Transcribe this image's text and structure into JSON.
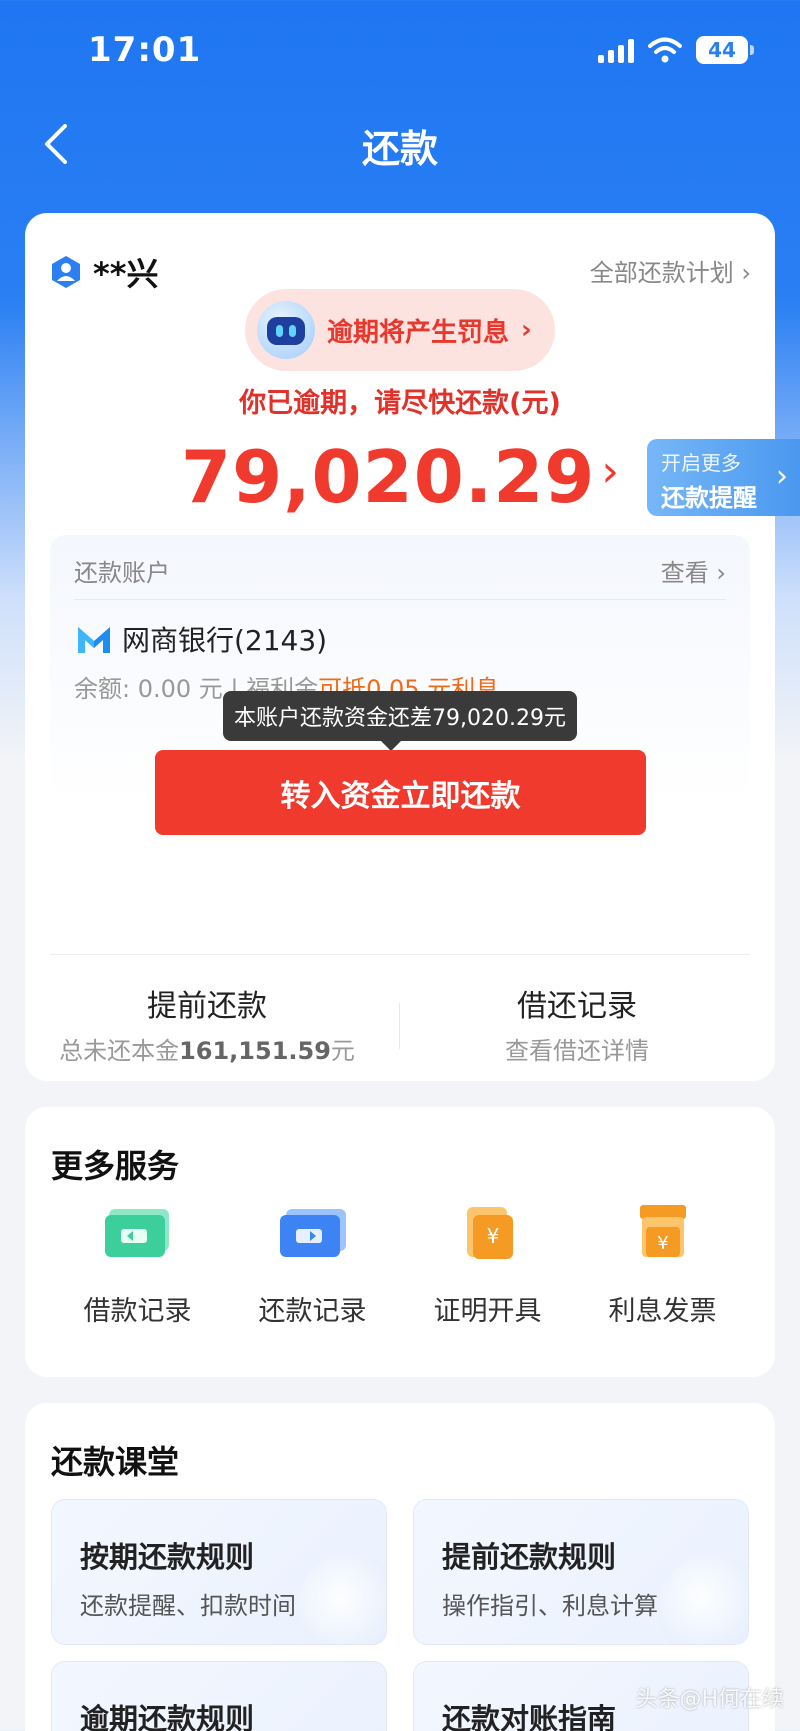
{
  "status_bar": {
    "time": "17:01",
    "battery": "44"
  },
  "nav": {
    "title": "还款"
  },
  "account_summary": {
    "user_name": "**兴",
    "all_plans_link": "全部还款计划",
    "overdue_pill": "逾期将产生罚息",
    "overdue_message": "你已逾期，请尽快还款(元)",
    "amount_due": "79,020.29",
    "reminder_tab": {
      "line1": "开启更多",
      "line2": "还款提醒"
    }
  },
  "repay_account": {
    "label": "还款账户",
    "view_link": "查看",
    "bank_name": "网商银行(2143)",
    "balance_prefix": "余额: 0.00 元 | 福利金",
    "balance_highlight": "可抵0.05 元利息",
    "tooltip": "本账户还款资金还差79,020.29元",
    "pay_button": "转入资金立即还款"
  },
  "bottom_actions": [
    {
      "title": "提前还款",
      "subtitle_prefix": "总未还本金",
      "subtitle_value": "161,151.59",
      "subtitle_suffix": "元"
    },
    {
      "title": "借还记录",
      "subtitle": "查看借还详情"
    }
  ],
  "more_services": {
    "title": "更多服务",
    "items": [
      {
        "label": "借款记录",
        "icon": "loan-record-icon",
        "color": "#3ccf9b"
      },
      {
        "label": "还款记录",
        "icon": "repay-record-icon",
        "color": "#3d83f3"
      },
      {
        "label": "证明开具",
        "icon": "certificate-icon",
        "color": "#f59a23"
      },
      {
        "label": "利息发票",
        "icon": "invoice-icon",
        "color": "#f59a23"
      }
    ]
  },
  "classroom": {
    "title": "还款课堂",
    "items": [
      {
        "title": "按期还款规则",
        "subtitle": "还款提醒、扣款时间"
      },
      {
        "title": "提前还款规则",
        "subtitle": "操作指引、利息计算"
      },
      {
        "title": "逾期还款规则",
        "subtitle": ""
      },
      {
        "title": "还款对账指南",
        "subtitle": ""
      }
    ]
  },
  "watermark": "头条@H何在续",
  "colors": {
    "primary_blue": "#1f76f2",
    "alert_red": "#f03a2e",
    "highlight_orange": "#f06a1b"
  }
}
